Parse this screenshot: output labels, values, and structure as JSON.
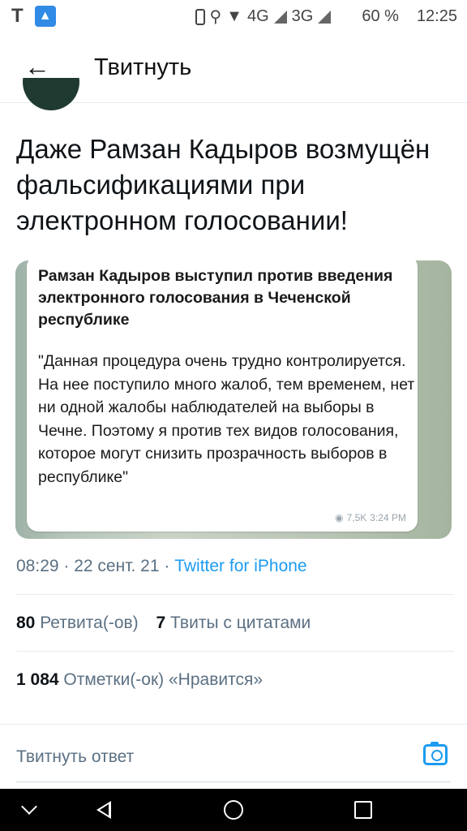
{
  "status_bar": {
    "left_letter": "T",
    "left_app_icon": "rocket-icon",
    "network_4g": "4G",
    "network_3g": "3G",
    "battery": "60 %",
    "time": "12:25"
  },
  "header": {
    "title": "Твитнуть"
  },
  "tweet": {
    "text": "Даже Рамзан Кадыров возмущён фальсификациями при электронном голосовании!",
    "media": {
      "title": "Рамзан Кадыров выступил против введения электронного голосования в Чеченской республике",
      "body": "\"Данная процедура очень трудно контролируется. На нее поступило много жалоб, тем временем, нет ни одной жалобы наблюдателей на выборы в Чечне. Поэтому я против тех видов голосования, которое могут снизить прозрачность выборов в республике\"",
      "views": "7,5K",
      "time": "3:24 PM"
    },
    "meta": {
      "time": "08:29",
      "date": "22 сент. 21",
      "source": "Twitter for iPhone",
      "sep": " · "
    },
    "stats": {
      "retweets_count": "80",
      "retweets_label": "Ретвита(-ов)",
      "quotes_count": "7",
      "quotes_label": "Твиты с цитатами",
      "likes_count": "1 084",
      "likes_label": "Отметки(-ок) «Нравится»"
    }
  },
  "reply": {
    "placeholder": "Твитнуть ответ"
  },
  "colors": {
    "accent": "#1d9bf0",
    "secondary_text": "#5b7083"
  }
}
